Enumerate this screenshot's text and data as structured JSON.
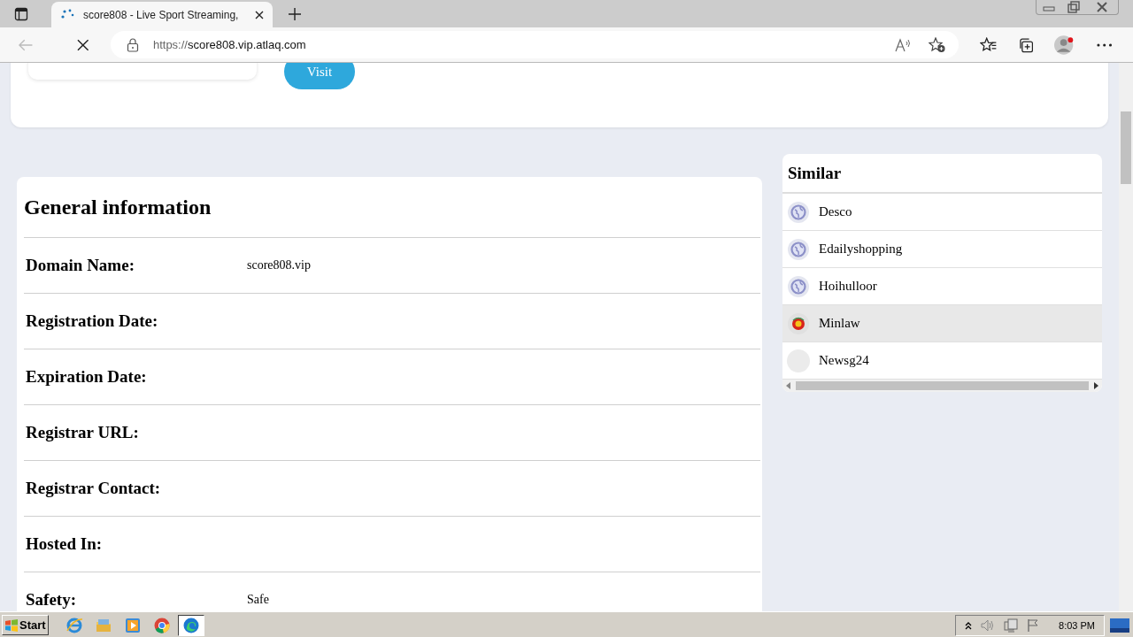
{
  "browser": {
    "tabs": [
      {
        "title": "score808 - Live Sport Streaming, ",
        "selected": true
      }
    ],
    "url_scheme": "https://",
    "url_host": "score808.vip.atlaq.com"
  },
  "top_card": {
    "visit_button": "Visit"
  },
  "general_information": {
    "title": "General information",
    "rows": [
      {
        "label": "Domain Name:",
        "value": "score808.vip"
      },
      {
        "label": "Registration Date:"
      },
      {
        "label": "Expiration Date:"
      },
      {
        "label": "Registrar URL:"
      },
      {
        "label": "Registrar Contact:"
      },
      {
        "label": "Hosted In:"
      },
      {
        "label": "Safety:",
        "value": "Safe"
      }
    ]
  },
  "similar": {
    "title": "Similar",
    "items": [
      {
        "name": "Desco",
        "kind": "globe",
        "selected": false
      },
      {
        "name": "Edailyshopping",
        "kind": "globe",
        "selected": false
      },
      {
        "name": "Hoihulloor",
        "kind": "globe",
        "selected": false
      },
      {
        "name": "Minlaw",
        "kind": "logo",
        "selected": true
      },
      {
        "name": "Newsg24",
        "kind": "blank",
        "selected": false
      }
    ]
  },
  "taskbar": {
    "start": "Start",
    "apps": [
      {
        "kind": "ie",
        "selected": false
      },
      {
        "kind": "folder",
        "selected": false
      },
      {
        "kind": "media",
        "selected": false
      },
      {
        "kind": "chrome",
        "selected": false
      },
      {
        "kind": "edge",
        "selected": true
      }
    ],
    "clock": "8:03 PM"
  }
}
